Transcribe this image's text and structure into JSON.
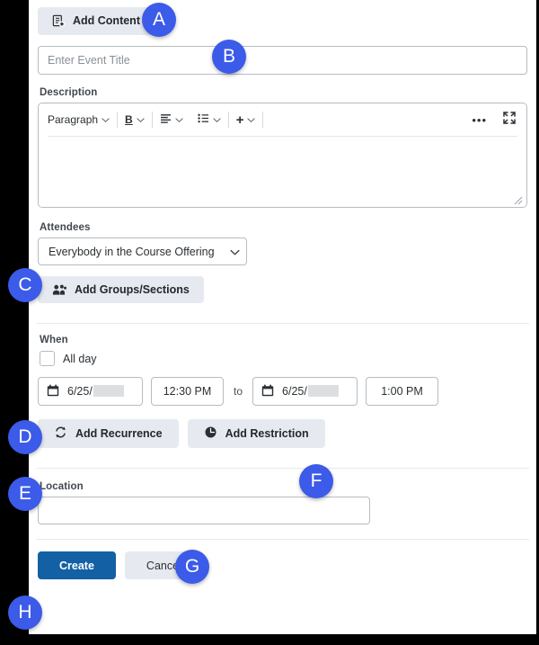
{
  "window": {
    "background_color": "#000000",
    "panel_color": "#ffffff",
    "accent_color": "#1360a4",
    "badge_color": "#3b5be8"
  },
  "add_content": {
    "label": "Add Content",
    "icon": "content-plus-icon"
  },
  "title": {
    "placeholder": "Enter Event Title",
    "value": ""
  },
  "description": {
    "label": "Description",
    "toolbar": {
      "style_select": "Paragraph",
      "bold": "B",
      "align": "align-left-icon",
      "list": "bullet-list-icon",
      "insert": "+",
      "more": "•••",
      "fullscreen": "fullscreen-icon"
    },
    "body_value": ""
  },
  "attendees": {
    "label": "Attendees",
    "selected": "Everybody in the Course Offering",
    "options": [
      "Everybody in the Course Offering"
    ],
    "add_groups_label": "Add Groups/Sections"
  },
  "when": {
    "label": "When",
    "all_day_label": "All day",
    "all_day_checked": false,
    "start_date": "6/25/",
    "start_date_redacted": true,
    "start_time": "12:30 PM",
    "separator": "to",
    "end_date": "6/25/",
    "end_date_redacted": true,
    "end_time": "1:00 PM",
    "add_recurrence_label": "Add Recurrence",
    "add_restriction_label": "Add Restriction"
  },
  "location": {
    "label": "Location",
    "value": "",
    "placeholder": ""
  },
  "footer": {
    "create_label": "Create",
    "cancel_label": "Cancel"
  },
  "callouts": [
    {
      "id": "A",
      "label": "A",
      "target": "add-content-button"
    },
    {
      "id": "B",
      "label": "B",
      "target": "event-title-input"
    },
    {
      "id": "C",
      "label": "C",
      "target": "attendees-select"
    },
    {
      "id": "D",
      "label": "D",
      "target": "start-date-field"
    },
    {
      "id": "E",
      "label": "E",
      "target": "add-recurrence-button"
    },
    {
      "id": "F",
      "label": "F",
      "target": "add-restriction-button"
    },
    {
      "id": "G",
      "label": "G",
      "target": "location-input"
    },
    {
      "id": "H",
      "label": "H",
      "target": "create-button"
    }
  ]
}
